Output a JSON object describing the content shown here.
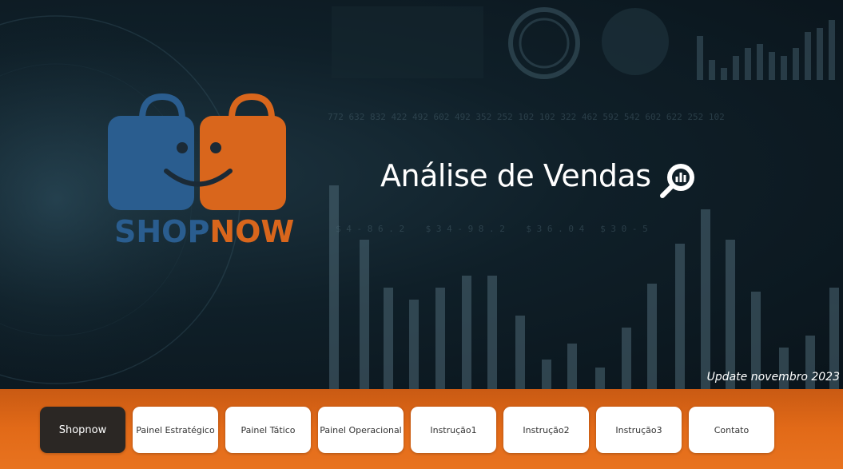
{
  "brand": {
    "part1": "SHOP",
    "part2": "NOW",
    "color1": "#2a5d8f",
    "color2": "#d9661c"
  },
  "headline": "Análise de Vendas",
  "update_text": "Update novembro 2023",
  "colors": {
    "nav_bg": "#e26a18",
    "active_btn": "#2b2724",
    "hero_bg": "#0f1f28"
  },
  "icons": [
    "shopping-bags-logo-icon",
    "search-chart-icon"
  ],
  "nav": {
    "items": [
      {
        "label": "Shopnow",
        "active": true
      },
      {
        "label": "Painel Estratégico"
      },
      {
        "label": "Painel Tático"
      },
      {
        "label": "Painel Operacional"
      },
      {
        "label": "Instrução1"
      },
      {
        "label": "Instrução2"
      },
      {
        "label": "Instrução3"
      },
      {
        "label": "Contato"
      }
    ]
  }
}
